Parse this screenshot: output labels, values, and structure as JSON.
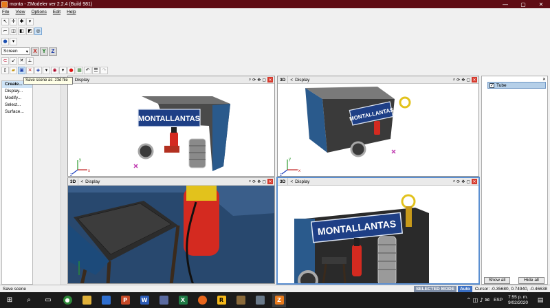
{
  "window": {
    "title": "monta - ZModeler ver 2.2.4 (Build 981)",
    "minimize": "—",
    "maximize": "▢",
    "close": "✕"
  },
  "menu": [
    "File",
    "View",
    "Options",
    "Edit",
    "Help"
  ],
  "toolbar": {
    "screen_select": "Screen",
    "axis_x": "X",
    "axis_y": "Y",
    "axis_z": "Z",
    "tooltip": "Save scene as .z3d file"
  },
  "left_panel": {
    "items": [
      "Create...",
      "Display...",
      "Modify...",
      "Select...",
      "Surface..."
    ]
  },
  "viewports": [
    {
      "mode": "3D",
      "nav": "<",
      "label": "Display",
      "banner": "MONTALLANTAS"
    },
    {
      "mode": "3D",
      "nav": "<",
      "label": "Display",
      "banner": "MONTALLANTAS"
    },
    {
      "mode": "3D",
      "nav": "<",
      "label": "Display",
      "banner": ""
    },
    {
      "mode": "3D",
      "nav": "<",
      "label": "Display",
      "banner": "MONTALLANTAS"
    }
  ],
  "axis_labels": {
    "x": "x",
    "y": "y",
    "z": "z"
  },
  "right_panel": {
    "item": "Tube",
    "show_all": "Show all",
    "hide_all": "Hide all"
  },
  "status": {
    "left": "Save scene",
    "mode": "SELECTED MODE",
    "auto": "Auto",
    "cursor": "Cursor: -0.35680, 0.74940, -0.46638"
  },
  "taskbar": {
    "lang": "ESP",
    "time": "7:55 p. m.",
    "date": "9/02/2020"
  },
  "colors": {
    "titlebar": "#5f0c14",
    "accent": "#3a6fc4",
    "banner": "#1e3f86"
  }
}
